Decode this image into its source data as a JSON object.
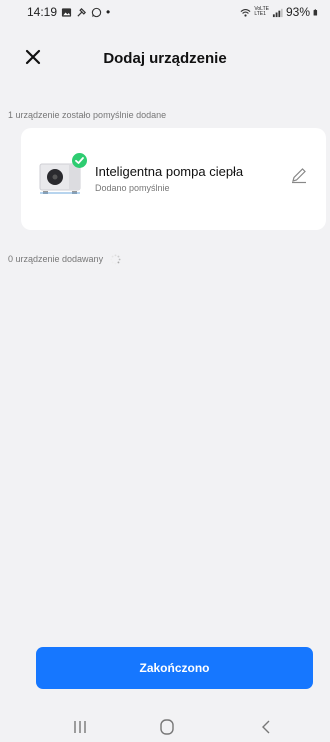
{
  "status_bar": {
    "time": "14:19",
    "dot": "•",
    "battery": "93%",
    "net_label_top": "VoLTE",
    "net_label_bottom": "LTE1"
  },
  "header": {
    "title": "Dodaj urządzenie",
    "close_icon": "close-icon"
  },
  "added_section": {
    "label": "1 urządzenie zostało pomyślnie dodane",
    "device": {
      "name": "Inteligentna pompa ciepła",
      "status": "Dodano pomyślnie"
    }
  },
  "adding_section": {
    "label": "0 urządzenie dodawany"
  },
  "footer": {
    "done_label": "Zakończono"
  },
  "colors": {
    "accent": "#1677ff",
    "success": "#2ecc71",
    "background": "#f2f2f4"
  }
}
